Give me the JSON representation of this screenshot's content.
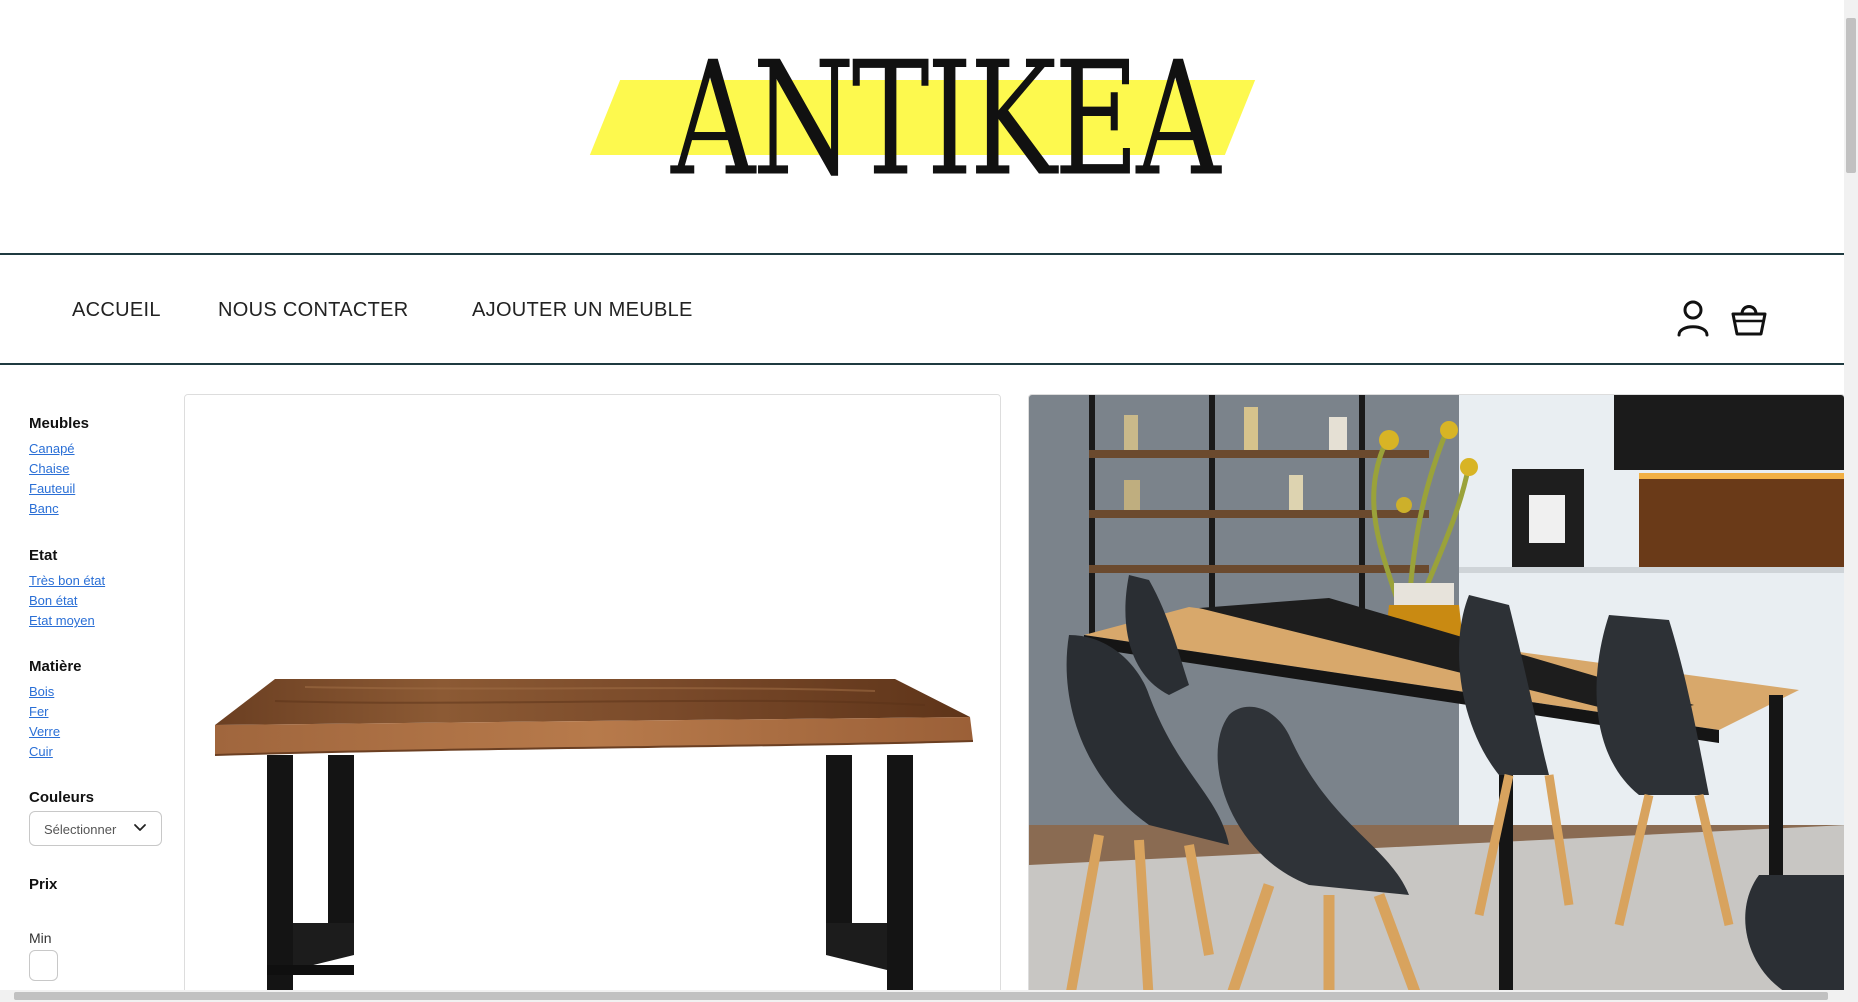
{
  "brand": {
    "logo_text": "ANTIKEA",
    "accent_color": "#fdf94e"
  },
  "nav": {
    "links": [
      "ACCUEIL",
      "NOUS CONTACTER",
      "AJOUTER UN MEUBLE"
    ],
    "icons": [
      "user-icon",
      "shopping-basket-icon"
    ]
  },
  "sidebar": {
    "furniture": {
      "title": "Meubles",
      "items": [
        "Canapé",
        "Chaise",
        "Fauteuil",
        "Banc"
      ]
    },
    "condition": {
      "title": "Etat",
      "items": [
        "Très bon état",
        "Bon état",
        "Etat moyen"
      ]
    },
    "material": {
      "title": "Matière",
      "items": [
        "Bois",
        "Fer",
        "Verre",
        "Cuir"
      ]
    },
    "colors": {
      "title": "Couleurs",
      "select_value": "Sélectionner"
    },
    "price": {
      "title": "Prix",
      "min_label": "Min"
    }
  },
  "products": {
    "items": [
      {
        "image": "wooden-table-photo"
      },
      {
        "image": "dining-room-photo"
      }
    ]
  }
}
